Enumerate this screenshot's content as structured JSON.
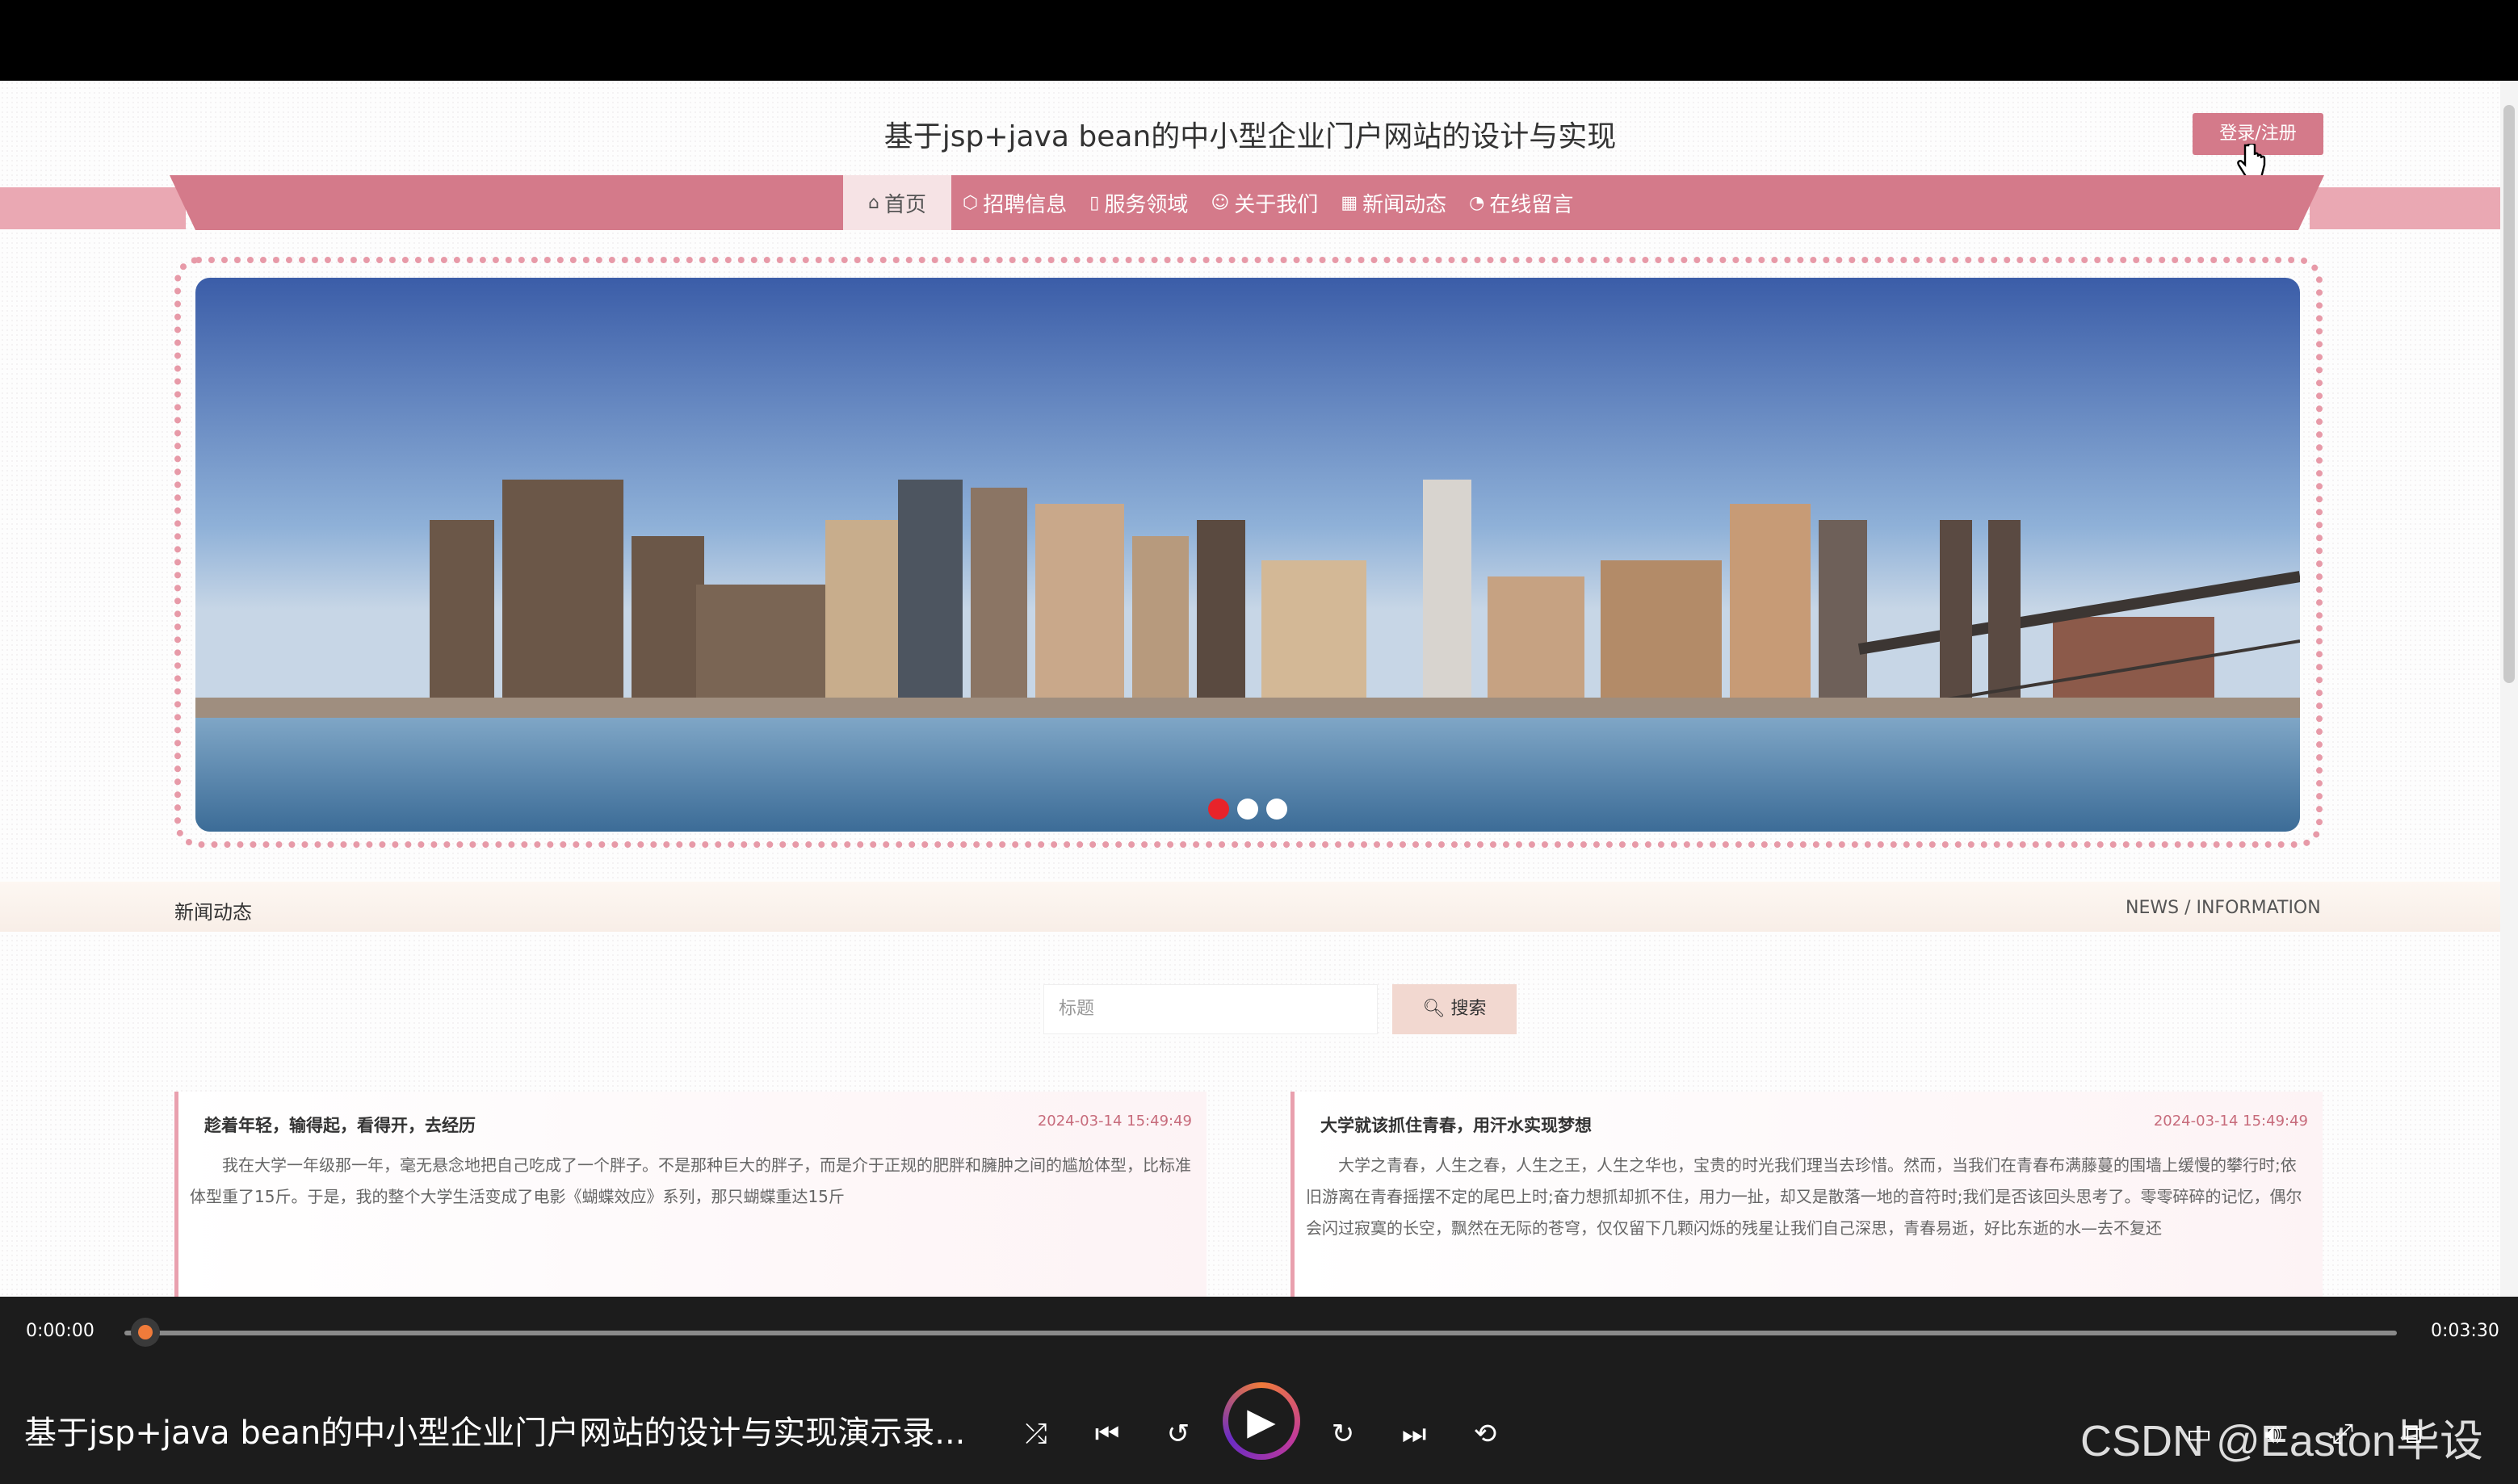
{
  "site": {
    "title": "基于jsp+java bean的中小型企业门户网站的设计与实现",
    "login_label": "登录/注册"
  },
  "nav": {
    "items": [
      {
        "label": "首页",
        "icon": "home-icon",
        "glyph": "⌂",
        "active": true
      },
      {
        "label": "招聘信息",
        "icon": "cube-icon",
        "glyph": "⬡"
      },
      {
        "label": "服务领域",
        "icon": "document-icon",
        "glyph": "▯"
      },
      {
        "label": "关于我们",
        "icon": "smile-icon",
        "glyph": "☺"
      },
      {
        "label": "新闻动态",
        "icon": "grid-icon",
        "glyph": "▦"
      },
      {
        "label": "在线留言",
        "icon": "gauge-icon",
        "glyph": "◔"
      }
    ]
  },
  "carousel": {
    "slide_count": 3,
    "active_index": 0,
    "image": "city-skyline-with-bridge"
  },
  "news": {
    "section_title": "新闻动态",
    "section_en": "NEWS / INFORMATION",
    "search_placeholder": "标题",
    "search_label": "搜索",
    "items": [
      {
        "title": "趁着年轻，输得起，看得开，去经历",
        "date": "2024-03-14 15:49:49",
        "summary": "我在大学一年级那一年，毫无悬念地把自己吃成了一个胖子。不是那种巨大的胖子，而是介于正规的肥胖和臃肿之间的尴尬体型，比标准体型重了15斤。于是，我的整个大学生活变成了电影《蝴蝶效应》系列，那只蝴蝶重达15斤"
      },
      {
        "title": "大学就该抓住青春，用汗水实现梦想",
        "date": "2024-03-14 15:49:49",
        "summary": "大学之青春，人生之春，人生之王，人生之华也，宝贵的时光我们理当去珍惜。然而，当我们在青春布满藤蔓的围墙上缓慢的攀行时;依旧游离在青春摇摆不定的尾巴上时;奋力想抓却抓不住，用力一扯，却又是散落一地的音符时;我们是否该回头思考了。零零碎碎的记忆，偶尔会闪过寂寞的长空，飘然在无际的苍穹，仅仅留下几颗闪烁的残星让我们自己深思，青春易逝，好比东逝的水—去不复还"
      }
    ]
  },
  "player": {
    "current_time": "0:00:00",
    "total_time": "0:03:30",
    "progress": 0.0,
    "video_title": "基于jsp+java bean的中小型企业门户网站的设计与实现演示录...",
    "watermark": "CSDN @Easton毕设"
  },
  "colors": {
    "accent": "#d47a8a",
    "ribbon": "#eaa8b3",
    "dot_active": "#e8232a",
    "player_bg": "#1c1c1c"
  }
}
